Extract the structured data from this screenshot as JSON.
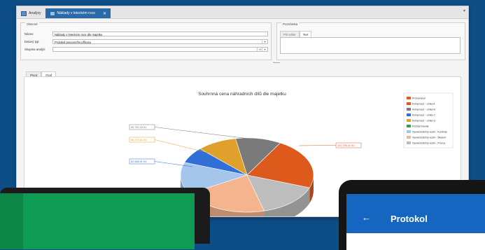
{
  "tabs": [
    {
      "label": "Analýzy"
    },
    {
      "label": "Náklady v leteckém roce"
    }
  ],
  "general": {
    "legend": "Obecné",
    "rows": [
      {
        "label": "Název:",
        "value": "Náklady v leteckém roce dle majetku"
      },
      {
        "label": "Datový typ:",
        "value": "Protokol pracovního příkazu"
      },
      {
        "label": "Skupina analýz:",
        "value": ""
      }
    ]
  },
  "note": {
    "legend": "Poznámka",
    "tabs": [
      "Pól editor",
      "Text"
    ]
  },
  "view_tabs": [
    "Pivot",
    "Graf"
  ],
  "chart_data": {
    "type": "pie",
    "title": "Souhrnná cena náhradních dílů dle majetku",
    "legend_position": "top-right",
    "series": [
      {
        "name": "Promoneod",
        "color": "#e35d1a"
      },
      {
        "name": "Kompresor - Linka A",
        "color": "#dd5a1c"
      },
      {
        "name": "Kompresor - Linka B",
        "color": "#777777"
      },
      {
        "name": "Kompresor - Linka C",
        "color": "#2f6fd6"
      },
      {
        "name": "Kompresor - Linka G",
        "color": "#e0a12c"
      },
      {
        "name": "Počítač-Novák",
        "color": "#3a9d45"
      },
      {
        "name": "Vysokozdvižný vozík - Kontrola",
        "color": "#a3c6ea"
      },
      {
        "name": "Vysokozdvižný vozík - Školení",
        "color": "#f4b48e"
      },
      {
        "name": "Vysokozdvižný vozík - Provoz",
        "color": "#bdbdbd"
      }
    ],
    "labels": [
      {
        "text": "131 206,41 Kč",
        "color": "#dd5a1c"
      },
      {
        "text": "95 782,16 Kč",
        "color": "#777777"
      },
      {
        "text": "84 703,61 Kč",
        "color": "#e0a12c"
      },
      {
        "text": "62 468,91 Kč",
        "color": "#2f6fd6"
      }
    ]
  },
  "tablet": {
    "back": "←",
    "title": "Protokol"
  }
}
